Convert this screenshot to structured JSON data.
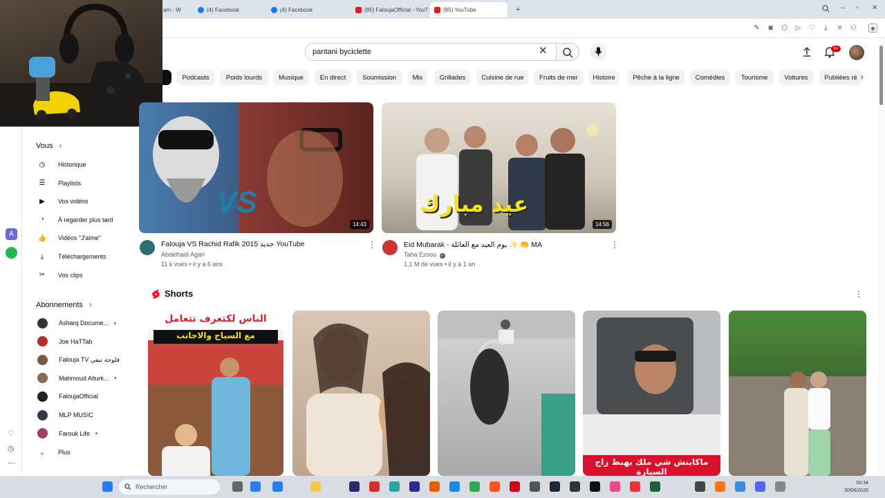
{
  "browser": {
    "tabs": [
      {
        "label": "am - W",
        "icon": "tab-icon"
      },
      {
        "label": "(4) Facebook",
        "icon": "facebook-icon"
      },
      {
        "label": "(4) Facebook",
        "icon": "facebook-icon"
      },
      {
        "label": "(85) FaloujaOfficial - YouT",
        "icon": "youtube-icon"
      },
      {
        "label": "(85) YouTube",
        "icon": "youtube-icon"
      }
    ],
    "new_tab_label": "+"
  },
  "youtube": {
    "search": {
      "value": "pantani byciclette"
    },
    "notification_count": "9+",
    "chips": [
      "s",
      "Podcasts",
      "Poids lourds",
      "Musique",
      "En direct",
      "Soumission",
      "Mix",
      "Grillades",
      "Cuisine de rue",
      "Fruits de mer",
      "Histoire",
      "Pêche à la ligne",
      "Comédies",
      "Tourisme",
      "Voitures",
      "Publiées ré"
    ],
    "sidebar": {
      "you_header": "Vous",
      "you_items": [
        {
          "label": "Historique",
          "icon": "history-icon"
        },
        {
          "label": "Playlists",
          "icon": "playlist-icon"
        },
        {
          "label": "Vos vidéos",
          "icon": "video-icon"
        },
        {
          "label": "À regarder plus tard",
          "icon": "clock-icon"
        },
        {
          "label": "Vidéos \"J'aime\"",
          "icon": "thumbs-up-icon"
        },
        {
          "label": "Téléchargements",
          "icon": "download-icon"
        },
        {
          "label": "Vos clips",
          "icon": "scissors-icon"
        }
      ],
      "subs_header": "Abonnements",
      "subscriptions": [
        {
          "label": "Asharq Docume...",
          "dot": "•",
          "color": "#333333"
        },
        {
          "label": "Joe HaTTab",
          "dot": "",
          "color": "#b52a2a"
        },
        {
          "label": "Falouja TV فلوجة تيفي",
          "dot": "",
          "color": "#7a5a40"
        },
        {
          "label": "Mahmoud Alturk...",
          "dot": "•",
          "color": "#8a6a50"
        },
        {
          "label": "FaloujaOfficial",
          "dot": "",
          "color": "#222222"
        },
        {
          "label": "MLP MUSIC",
          "dot": "",
          "color": "#2f3a4a"
        },
        {
          "label": "Farouk Life",
          "dot": "•",
          "color": "#a04060"
        }
      ],
      "more_label": "Plus"
    },
    "videos": [
      {
        "title": "Falouja VS Rachid Rafik 2015 جديد   YouTube",
        "channel": "Abdelhadi Agari",
        "meta": "11 k vues • il y a 6 ans",
        "duration": "14:43",
        "overlay": "VS"
      },
      {
        "title": "Eid Mubarak - يوم العيد مع العائلة ✨ 🤲 MA",
        "channel": "Taha Essou",
        "meta": "1,1 M de vues • il y a 1 an",
        "duration": "14:56",
        "overlay": "عيد مبارك"
      }
    ],
    "shorts": {
      "title": "Shorts",
      "items": [
        {
          "caption": "الناس لكتعرف تتعامل",
          "subcaption": "مع السياح والاجانب"
        },
        {
          "caption": "",
          "subcaption": ""
        },
        {
          "caption": "",
          "subcaption": ""
        },
        {
          "caption": "ماكاينش شي ملك يهبط زاج السيارة",
          "subcaption": ""
        },
        {
          "caption": "",
          "subcaption": ""
        }
      ]
    }
  },
  "taskbar": {
    "search_placeholder": "Rechercher",
    "time": "00:34",
    "date": "30/06/2025"
  },
  "colors": {
    "youtube_red": "#ff0000",
    "chip_bg": "#f2f2f2",
    "taskbar_bg": "#d9dde3"
  }
}
